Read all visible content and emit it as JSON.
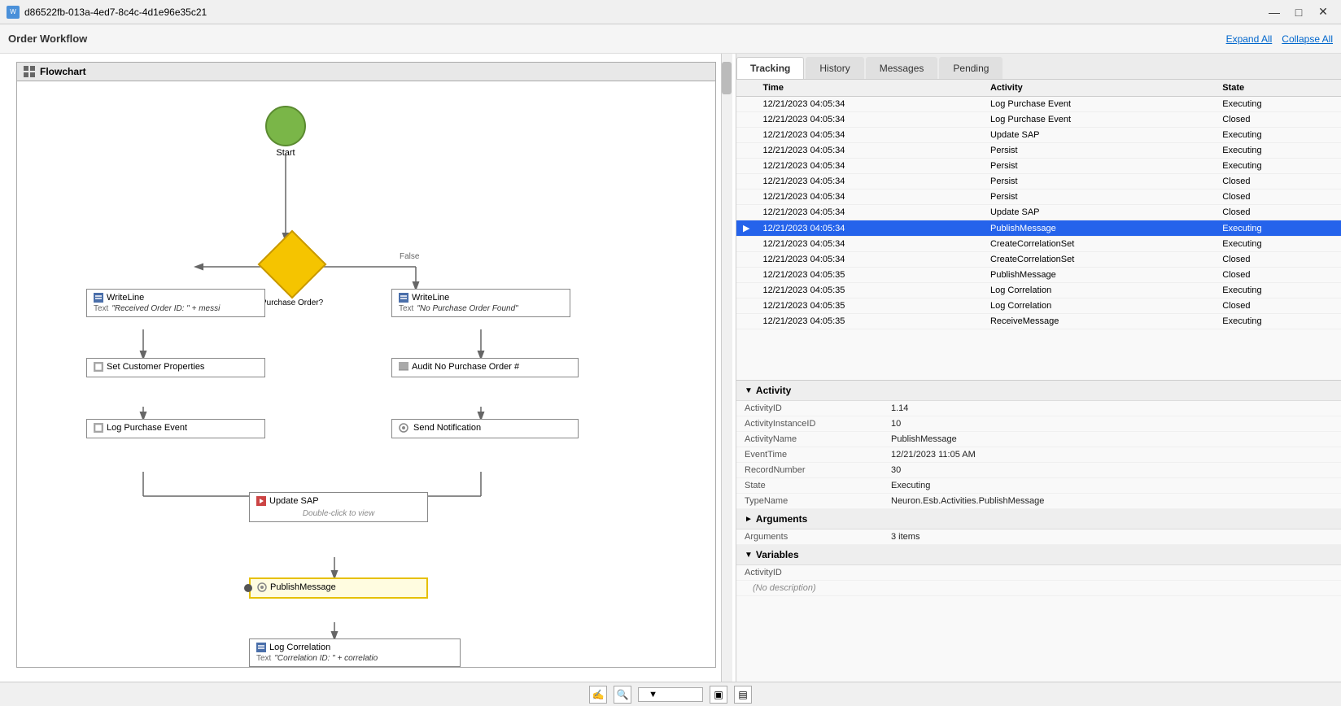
{
  "titlebar": {
    "title": "d86522fb-013a-4ed7-8c4c-4d1e96e35c21",
    "icon": "W"
  },
  "toolbar": {
    "title": "Order Workflow",
    "expand_all": "Expand All",
    "collapse_all": "Collapse All"
  },
  "tabs": [
    {
      "id": "tracking",
      "label": "Tracking",
      "active": true
    },
    {
      "id": "history",
      "label": "History",
      "active": false
    },
    {
      "id": "messages",
      "label": "Messages",
      "active": false
    },
    {
      "id": "pending",
      "label": "Pending",
      "active": false
    }
  ],
  "tracking_table": {
    "columns": [
      "Time",
      "Activity",
      "State"
    ],
    "rows": [
      {
        "time": "12/21/2023 04:05:34",
        "activity": "Log Purchase Event",
        "state": "Executing",
        "selected": false,
        "indicator": false
      },
      {
        "time": "12/21/2023 04:05:34",
        "activity": "Log Purchase Event",
        "state": "Closed",
        "selected": false,
        "indicator": false
      },
      {
        "time": "12/21/2023 04:05:34",
        "activity": "Update SAP",
        "state": "Executing",
        "selected": false,
        "indicator": false
      },
      {
        "time": "12/21/2023 04:05:34",
        "activity": "Persist",
        "state": "Executing",
        "selected": false,
        "indicator": false
      },
      {
        "time": "12/21/2023 04:05:34",
        "activity": "Persist",
        "state": "Executing",
        "selected": false,
        "indicator": false
      },
      {
        "time": "12/21/2023 04:05:34",
        "activity": "Persist",
        "state": "Closed",
        "selected": false,
        "indicator": false
      },
      {
        "time": "12/21/2023 04:05:34",
        "activity": "Persist",
        "state": "Closed",
        "selected": false,
        "indicator": false
      },
      {
        "time": "12/21/2023 04:05:34",
        "activity": "Update SAP",
        "state": "Closed",
        "selected": false,
        "indicator": false
      },
      {
        "time": "12/21/2023 04:05:34",
        "activity": "PublishMessage",
        "state": "Executing",
        "selected": true,
        "indicator": true
      },
      {
        "time": "12/21/2023 04:05:34",
        "activity": "CreateCorrelationSet",
        "state": "Executing",
        "selected": false,
        "indicator": false
      },
      {
        "time": "12/21/2023 04:05:34",
        "activity": "CreateCorrelationSet",
        "state": "Closed",
        "selected": false,
        "indicator": false
      },
      {
        "time": "12/21/2023 04:05:35",
        "activity": "PublishMessage",
        "state": "Closed",
        "selected": false,
        "indicator": false
      },
      {
        "time": "12/21/2023 04:05:35",
        "activity": "Log Correlation",
        "state": "Executing",
        "selected": false,
        "indicator": false
      },
      {
        "time": "12/21/2023 04:05:35",
        "activity": "Log Correlation",
        "state": "Closed",
        "selected": false,
        "indicator": false
      },
      {
        "time": "12/21/2023 04:05:35",
        "activity": "ReceiveMessage",
        "state": "Executing",
        "selected": false,
        "indicator": false
      }
    ]
  },
  "properties": {
    "activity_section": "Activity",
    "fields": [
      {
        "key": "ActivityID",
        "value": "1.14"
      },
      {
        "key": "ActivityInstanceID",
        "value": "10"
      },
      {
        "key": "ActivityName",
        "value": "PublishMessage"
      },
      {
        "key": "EventTime",
        "value": "12/21/2023 11:05 AM"
      },
      {
        "key": "RecordNumber",
        "value": "30"
      },
      {
        "key": "State",
        "value": "Executing"
      },
      {
        "key": "TypeName",
        "value": "Neuron.Esb.Activities.PublishMessage"
      }
    ],
    "arguments_section": "Arguments",
    "arguments_collapsed": true,
    "arguments_value": "3 items",
    "variables_section": "Variables",
    "variable_field": "ActivityID",
    "variable_desc": "(No description)"
  },
  "flowchart": {
    "title": "Flowchart",
    "nodes": {
      "start": {
        "label": "Start"
      },
      "writeline1": {
        "label": "WriteLine",
        "prop_label": "Text",
        "prop_value": "\"Received Order ID: \" + messi"
      },
      "decision": {
        "label": "Purchase Order?"
      },
      "writeline2": {
        "label": "WriteLine",
        "prop_label": "Text",
        "prop_value": "\"No Purchase Order Found\""
      },
      "set_customer": {
        "label": "Set Customer Properties"
      },
      "log_purchase": {
        "label": "Log Purchase Event"
      },
      "audit": {
        "label": "Audit No Purchase Order #"
      },
      "send_notification": {
        "label": "Send Notification"
      },
      "update_sap": {
        "label": "Update SAP",
        "sub_label": "Double-click to view"
      },
      "publish_message": {
        "label": "PublishMessage"
      },
      "log_correlation": {
        "label": "Log Correlation",
        "prop_label": "Text",
        "prop_value": "\"Correlation ID: \" + correlatio"
      },
      "false_label": "False"
    }
  },
  "statusbar": {
    "zoom_placeholder": ""
  }
}
